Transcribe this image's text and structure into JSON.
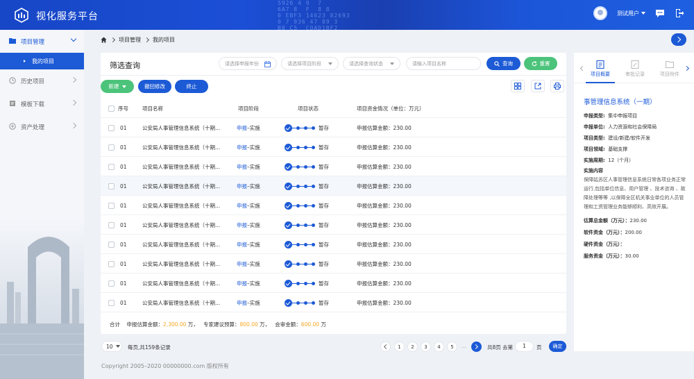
{
  "app": {
    "title": "视化服务平台"
  },
  "header": {
    "matrix_text": "5926 4 9  7\n6A7 8  F  8 8\n0 EBF3 14623 82693\n0 7 936 47 89 3\nB8 C5  COAD1BF2",
    "user_name": "测试用户"
  },
  "sidebar": {
    "items": [
      {
        "label": "项目管理",
        "icon": "folder-icon"
      },
      {
        "label": "历史项目",
        "icon": "clock-icon"
      },
      {
        "label": "模板下载",
        "icon": "download-icon"
      },
      {
        "label": "资产处理",
        "icon": "asset-icon"
      }
    ],
    "sub_item": "我的项目"
  },
  "breadcrumb": {
    "level1": "项目管理",
    "level2": "我的项目"
  },
  "filters": {
    "title": "筛选查询",
    "year_placeholder": "请选择申报年份",
    "stage_placeholder": "请选择项目阶段",
    "status_placeholder": "请选择查询状态",
    "name_placeholder": "请输入项目名称",
    "query_label": "查询",
    "reset_label": "重置"
  },
  "actions": {
    "new_label": "新建",
    "withdraw_label": "撤回修改",
    "stop_label": "终止"
  },
  "table": {
    "headers": {
      "index": "序号",
      "name": "项目名称",
      "stage": "项目阶段",
      "status": "项目状态",
      "funding": "项目资金情况（单位：万元）"
    },
    "rows": [
      {
        "index": "01",
        "name": "公安局人事管理信息系统（十期...",
        "stage_a": "申报",
        "stage_sep": "–",
        "stage_b": "实施",
        "status": "暂存",
        "funding": "申报估算金额：230.00"
      },
      {
        "index": "01",
        "name": "公安局人事管理信息系统（十期...",
        "stage_a": "申报",
        "stage_sep": "–",
        "stage_b": "实施",
        "status": "暂存",
        "funding": "申报估算金额：230.00"
      },
      {
        "index": "01",
        "name": "公安局人事管理信息系统（十期...",
        "stage_a": "申报",
        "stage_sep": "–",
        "stage_b": "实施",
        "status": "暂存",
        "funding": "申报估算金额：230.00"
      },
      {
        "index": "01",
        "name": "公安局人事管理信息系统（十期...",
        "stage_a": "申报",
        "stage_sep": "–",
        "stage_b": "实施",
        "status": "暂存",
        "funding": "申报估算金额：230.00"
      },
      {
        "index": "01",
        "name": "公安局人事管理信息系统（十期...",
        "stage_a": "申报",
        "stage_sep": "–",
        "stage_b": "实施",
        "status": "暂存",
        "funding": "申报估算金额：230.00"
      },
      {
        "index": "01",
        "name": "公安局人事管理信息系统（十期...",
        "stage_a": "申报",
        "stage_sep": "–",
        "stage_b": "实施",
        "status": "暂存",
        "funding": "申报估算金额：230.00"
      },
      {
        "index": "01",
        "name": "公安局人事管理信息系统（十期...",
        "stage_a": "申报",
        "stage_sep": "–",
        "stage_b": "实施",
        "status": "暂存",
        "funding": "申报估算金额：230.00"
      },
      {
        "index": "01",
        "name": "公安局人事管理信息系统（十期...",
        "stage_a": "申报",
        "stage_sep": "–",
        "stage_b": "实施",
        "status": "暂存",
        "funding": "申报估算金额：230.00"
      },
      {
        "index": "01",
        "name": "公安局人事管理信息系统（十期...",
        "stage_a": "申报",
        "stage_sep": "–",
        "stage_b": "实施",
        "status": "暂存",
        "funding": "申报估算金额：230.00"
      },
      {
        "index": "01",
        "name": "公安局人事管理信息系统（十期...",
        "stage_a": "申报",
        "stage_sep": "–",
        "stage_b": "实施",
        "status": "暂存",
        "funding": "申报估算金额：230.00"
      }
    ],
    "total": {
      "label": "合计",
      "declared_label": "申报估算金额：",
      "declared_value": "2,300.00",
      "declared_unit": "万，",
      "expert_label": "专家建议预算：",
      "expert_value": "800.00",
      "expert_unit": "万，",
      "approved_label": "会审金额：",
      "approved_value": "600.00",
      "approved_unit": "万"
    }
  },
  "pagination": {
    "page_size": "10",
    "info": "每页,共159条记录",
    "pages": [
      "1",
      "2",
      "3",
      "4",
      "5"
    ],
    "ellipsis": "...",
    "total_pages": "共8页 去第",
    "goto_value": "1",
    "unit": "页",
    "go_label": "确定"
  },
  "footer": {
    "copyright": "Copyright 2005–2020 00000000.com 版权所有"
  },
  "detail": {
    "tabs": [
      "项目概要",
      "审批记录",
      "项目附件"
    ],
    "title": "事管理信息系统（一期）",
    "fields": [
      {
        "label": "申报类型:",
        "value": "集中申报项目"
      },
      {
        "label": "申报单位:",
        "value": "人力资源和社会保障局"
      },
      {
        "label": "项目类型:",
        "value": "建设/新建/软件开发"
      },
      {
        "label": "项目领域:",
        "value": "基础支撑"
      },
      {
        "label": "实施周期:",
        "value": "12（个月）"
      }
    ],
    "content_label": "实施内容",
    "content": "保障姑苏区人事管理信息系统日常各项业务正常运行,包括单位信息、用户管理 、技术咨询 、故障处理等等 ,以保障全区机关事业单位的人员管理和工资管理业务能够顺利、高效开展。",
    "budget": [
      {
        "label": "估算总金额（万元）：",
        "value": "230.00"
      },
      {
        "label": "软件资金（万元）：",
        "value": "200.00"
      },
      {
        "label": "硬件资金（万元）：",
        "value": ""
      },
      {
        "label": "服务资金（万元）：",
        "value": "30.00"
      }
    ]
  },
  "colors": {
    "primary": "#1c5ad6",
    "success": "#4cc37a",
    "accent": "#f5a623"
  }
}
